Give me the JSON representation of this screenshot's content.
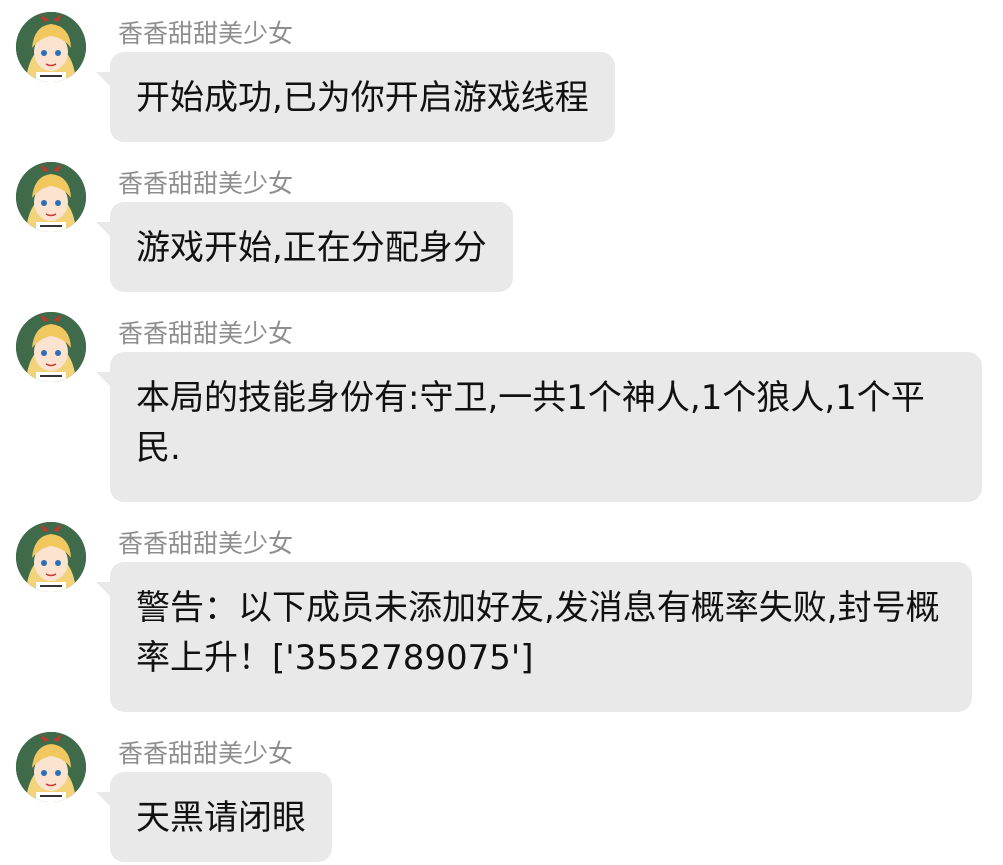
{
  "messages": [
    {
      "sender": "香香甜甜美少女",
      "text": "开始成功,已为你开启游戏线程"
    },
    {
      "sender": "香香甜甜美少女",
      "text": "游戏开始,正在分配身分"
    },
    {
      "sender": "香香甜甜美少女",
      "text": "本局的技能身份有:守卫,一共1个神人,1个狼人,1个平民."
    },
    {
      "sender": "香香甜甜美少女",
      "text": "警告：以下成员未添加好友,发消息有概率失败,封号概率上升！['3552789075']"
    },
    {
      "sender": "香香甜甜美少女",
      "text": "天黑请闭眼"
    }
  ],
  "colors": {
    "bubble": "#e9e9e9",
    "sender": "#8e8e8e",
    "text": "#111111",
    "avatar_bg": "#3f6b4b"
  },
  "icons": {
    "avatar": "anime-girl-avatar-icon"
  }
}
